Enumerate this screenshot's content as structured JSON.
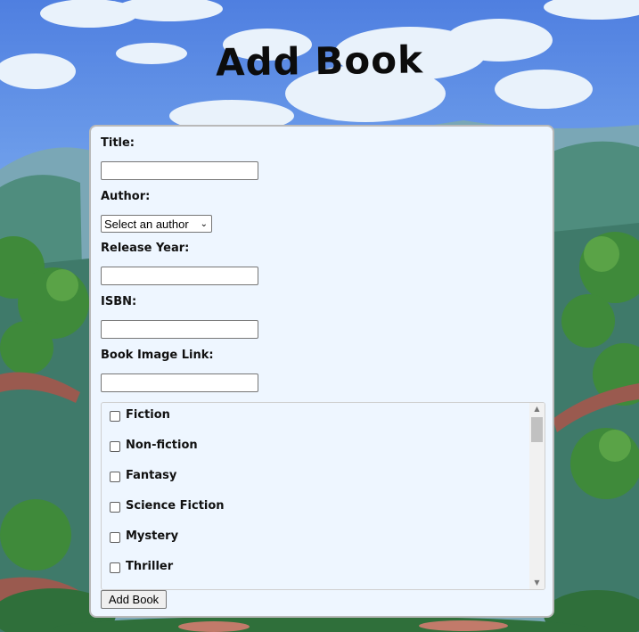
{
  "page": {
    "title": "Add Book"
  },
  "form": {
    "title_label": "Title:",
    "title_value": "",
    "author_label": "Author:",
    "author_selected": "Select an author",
    "release_year_label": "Release Year:",
    "release_year_value": "",
    "isbn_label": "ISBN:",
    "isbn_value": "",
    "image_link_label": "Book Image Link:",
    "image_link_value": "",
    "genres": [
      {
        "label": "Fiction",
        "checked": false
      },
      {
        "label": "Non-fiction",
        "checked": false
      },
      {
        "label": "Fantasy",
        "checked": false
      },
      {
        "label": "Science Fiction",
        "checked": false
      },
      {
        "label": "Mystery",
        "checked": false
      },
      {
        "label": "Thriller",
        "checked": false
      }
    ],
    "submit_label": "Add Book"
  },
  "colors": {
    "card_background": "#eef6ff",
    "sky": "#5b8fe6",
    "forest": "#3f7a6a"
  }
}
